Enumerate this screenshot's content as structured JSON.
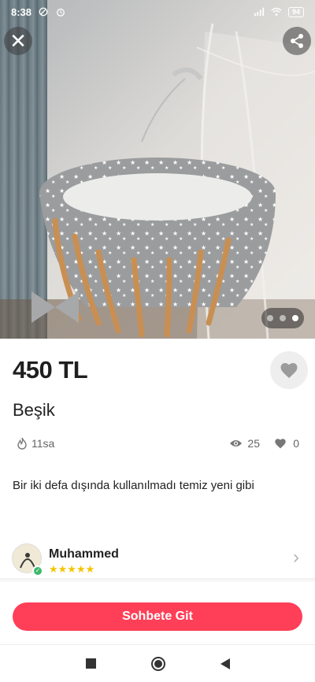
{
  "status_bar": {
    "time": "8:38",
    "battery": "94",
    "icons": [
      "do-not-disturb-icon",
      "alarm-icon",
      "signal-icon",
      "wifi-icon",
      "battery-icon"
    ]
  },
  "gallery": {
    "image_description_icon": "baby-cradle-photo",
    "page_count": 3,
    "active_page": 3,
    "close_icon": "close-icon",
    "share_icon": "share-icon"
  },
  "listing": {
    "price": "450 TL",
    "title": "Beşik",
    "posted_ago": "11sa",
    "views": "25",
    "likes": "0",
    "description": "Bir iki defa dışında kullanılmadı temiz yeni gibi"
  },
  "seller": {
    "name": "Muhammed",
    "rating_stars": 5,
    "stars": "★★★★★"
  },
  "actions": {
    "chat_label": "Sohbete Git"
  },
  "colors": {
    "accent": "#ff3f57",
    "star": "#f5c400",
    "verified": "#3bb96b"
  }
}
